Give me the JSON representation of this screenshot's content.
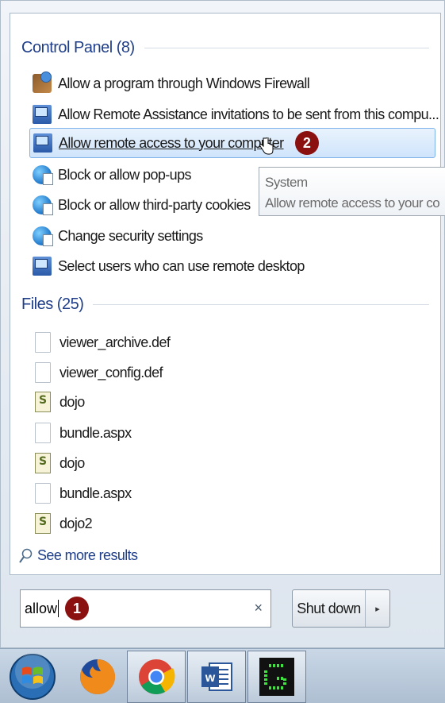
{
  "control_panel": {
    "header": "Control Panel (8)",
    "items": [
      {
        "label": "Allow a program through Windows Firewall",
        "icon": "firewall-icon"
      },
      {
        "label": "Allow Remote Assistance invitations to be sent from this compu...",
        "icon": "remote-icon"
      },
      {
        "label": "Allow remote access to your computer",
        "icon": "remote-icon",
        "highlighted": true,
        "step_badge": "2"
      },
      {
        "label": "Block or allow pop-ups",
        "icon": "internet-options-icon"
      },
      {
        "label": "Block or allow third-party cookies",
        "icon": "internet-options-icon"
      },
      {
        "label": "Change security settings",
        "icon": "internet-options-icon"
      },
      {
        "label": "Select users who can use remote desktop",
        "icon": "remote-icon"
      }
    ]
  },
  "tooltip": {
    "title": "System",
    "description": "Allow remote access to your co"
  },
  "files": {
    "header": "Files (25)",
    "items": [
      {
        "label": "viewer_archive.def",
        "icon": "file-icon"
      },
      {
        "label": "viewer_config.def",
        "icon": "file-icon"
      },
      {
        "label": "dojo",
        "icon": "script-icon"
      },
      {
        "label": "bundle.aspx",
        "icon": "file-icon"
      },
      {
        "label": "dojo",
        "icon": "script-icon"
      },
      {
        "label": "bundle.aspx",
        "icon": "file-icon"
      },
      {
        "label": "dojo2",
        "icon": "script-icon"
      }
    ]
  },
  "see_more": "See more results",
  "search": {
    "value": "allow",
    "step_badge": "1",
    "clear_glyph": "×"
  },
  "shutdown": {
    "label": "Shut down",
    "arrow": "▸"
  },
  "taskbar": {
    "items": [
      "start-orb",
      "firefox",
      "chrome",
      "word",
      "terminal"
    ]
  },
  "colors": {
    "badge": "#8b1111",
    "header_text": "#1e3e8a",
    "highlight_border": "#7eb4ea"
  }
}
